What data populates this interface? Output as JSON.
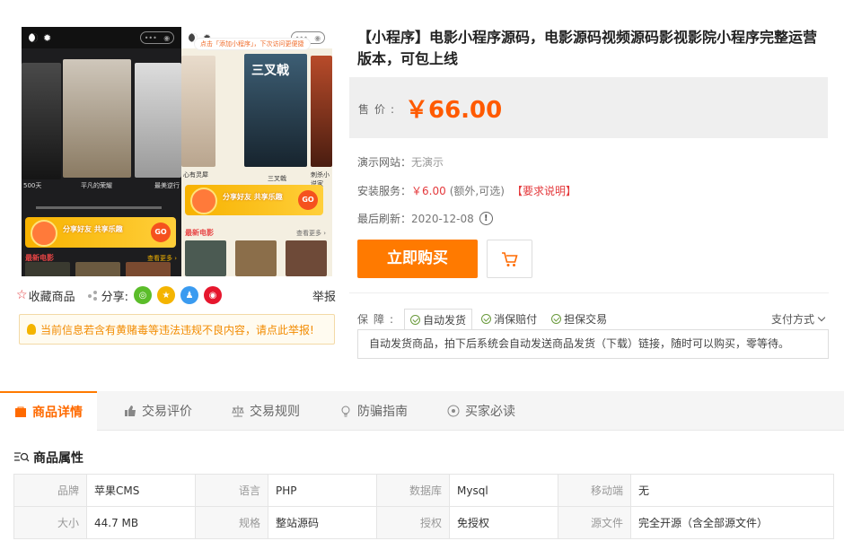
{
  "gallery": {
    "left": {
      "captions": [
        "500天",
        "平凡的荣耀",
        "最美逆行"
      ],
      "banner_text": "分享好友  共享乐趣",
      "go": "GO",
      "section": "最新电影",
      "more": "查看更多 ›"
    },
    "right": {
      "notice": "点击「添加小程序」，下次访问更便捷",
      "captions": [
        "心有灵犀",
        "三叉戟",
        "刺杀小说家"
      ],
      "banner_text": "分享好友  共享乐趣",
      "go": "GO",
      "section": "最新电影",
      "more": "查看更多 ›",
      "poster_title": "三叉戟"
    }
  },
  "actions": {
    "favorite": "收藏商品",
    "share": "分享:",
    "report": "举报"
  },
  "warning": "当前信息若含有黄赌毒等违法违规不良内容，请点此举报!",
  "product": {
    "title": "【小程序】电影小程序源码，电影源码视频源码影视影院小程序完整运营版本，可包上线",
    "price_label": "售价:",
    "price": "￥66.00",
    "demo_label": "演示网站：",
    "demo_value": "无演示",
    "service_label": "安装服务：",
    "service_price": "￥6.00",
    "service_note": "(额外,可选)",
    "service_req": "【要求说明】",
    "refresh_label": "最后刷新：",
    "refresh_date": "2020-12-08",
    "buy_label": "立即购买"
  },
  "guarantee": {
    "label": "保障:",
    "items": [
      "自动发货",
      "消保赔付",
      "担保交易"
    ],
    "payment": "支付方式",
    "description": "自动发货商品，拍下后系统会自动发送商品发货（下载）链接，随时可以购买，零等待。"
  },
  "tabs": [
    "商品详情",
    "交易评价",
    "交易规则",
    "防骗指南",
    "买家必读"
  ],
  "attributes": {
    "title": "商品属性",
    "rows": [
      [
        [
          "品牌",
          "苹果CMS"
        ],
        [
          "语言",
          "PHP"
        ],
        [
          "数据库",
          "Mysql"
        ],
        [
          "移动端",
          "无"
        ]
      ],
      [
        [
          "大小",
          "44.7 MB"
        ],
        [
          "规格",
          "整站源码"
        ],
        [
          "授权",
          "免授权"
        ],
        [
          "源文件",
          "完全开源（含全部源文件）"
        ]
      ]
    ]
  },
  "colors": {
    "accent": "#ff7a00",
    "price": "#ff5a00",
    "danger": "#e4393c",
    "wechat": "#5bbd2a",
    "qzone": "#f4b400",
    "qq": "#3a9bf0",
    "weibo": "#e6162d"
  }
}
